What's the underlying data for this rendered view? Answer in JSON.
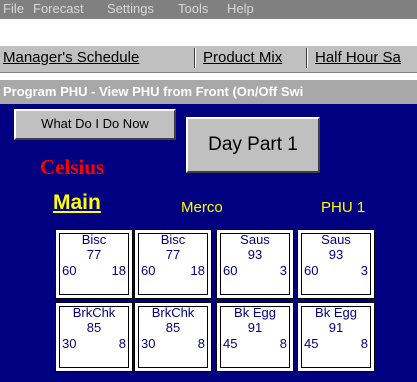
{
  "menu": [
    "File",
    "Forecast",
    "Settings",
    "Tools",
    "Help"
  ],
  "tabs": [
    "Manager's Schedule",
    "Product Mix",
    "Half Hour Sa"
  ],
  "title": "Program PHU - View PHU from Front (On/Off Swi",
  "buttons": {
    "help": "What Do I Do Now",
    "day_part": "Day Part 1"
  },
  "labels": {
    "units": "Celsius",
    "main": "Main",
    "merco": "Merco",
    "phu": "PHU 1"
  },
  "cells": [
    {
      "name": "Bisc",
      "temp": "77",
      "a": "60",
      "b": "18"
    },
    {
      "name": "Bisc",
      "temp": "77",
      "a": "60",
      "b": "18"
    },
    {
      "name": "Saus",
      "temp": "93",
      "a": "60",
      "b": "3"
    },
    {
      "name": "Saus",
      "temp": "93",
      "a": "60",
      "b": "3"
    },
    {
      "name": "BrkChk",
      "temp": "85",
      "a": "30",
      "b": "8"
    },
    {
      "name": "BrkChk",
      "temp": "85",
      "a": "30",
      "b": "8"
    },
    {
      "name": "Bk Egg",
      "temp": "91",
      "a": "45",
      "b": "8"
    },
    {
      "name": "Bk Egg",
      "temp": "91",
      "a": "45",
      "b": "8"
    }
  ]
}
